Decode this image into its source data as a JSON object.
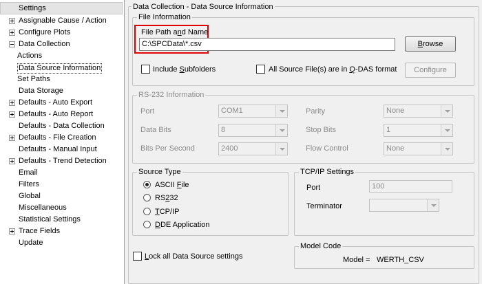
{
  "tree": {
    "header": "Settings",
    "items": [
      {
        "label": "Assignable Cause / Action",
        "expander": "plus"
      },
      {
        "label": "Configure Plots",
        "expander": "plus"
      },
      {
        "label": "Data Collection",
        "expander": "minus"
      },
      {
        "label": "Actions",
        "expander": "none",
        "child": true
      },
      {
        "label": "Data Source Information",
        "expander": "none",
        "child": true,
        "selected": true
      },
      {
        "label": "Set Paths",
        "expander": "none",
        "child": true
      },
      {
        "label": "Data Storage",
        "expander": "none"
      },
      {
        "label": "Defaults - Auto Export",
        "expander": "plus"
      },
      {
        "label": "Defaults - Auto Report",
        "expander": "plus"
      },
      {
        "label": "Defaults - Data Collection",
        "expander": "none"
      },
      {
        "label": "Defaults - File Creation",
        "expander": "plus"
      },
      {
        "label": "Defaults - Manual Input",
        "expander": "none"
      },
      {
        "label": "Defaults - Trend Detection",
        "expander": "plus"
      },
      {
        "label": "Email",
        "expander": "none"
      },
      {
        "label": "Filters",
        "expander": "none"
      },
      {
        "label": "Global",
        "expander": "none"
      },
      {
        "label": "Miscellaneous",
        "expander": "none"
      },
      {
        "label": "Statistical Settings",
        "expander": "none"
      },
      {
        "label": "Trace Fields",
        "expander": "plus"
      },
      {
        "label": "Update",
        "expander": "none"
      }
    ]
  },
  "main_group": {
    "title": "Data Collection - Data Source Information"
  },
  "file_info": {
    "title": "File Information",
    "path_label_pre": "File Path a",
    "path_label_ul": "n",
    "path_label_post": "d Name",
    "path_value": "C:\\SPCData\\*.csv",
    "browse_ul": "B",
    "browse_rest": "rowse",
    "include_pre": "Include ",
    "include_ul": "S",
    "include_post": "ubfolders",
    "all_pre": "All Source File(s) are in ",
    "all_ul": "Q",
    "all_post": "-DAS format",
    "configure_label": "Configure"
  },
  "rs232": {
    "title": "RS-232 Information",
    "port_label": "Port",
    "port_value": "COM1",
    "databits_label": "Data Bits",
    "databits_value": "8",
    "bps_label": "Bits Per Second",
    "bps_value": "2400",
    "parity_label": "Parity",
    "parity_value": "None",
    "stopbits_label": "Stop Bits",
    "stopbits_value": "1",
    "flow_label": "Flow Control",
    "flow_value": "None"
  },
  "source_type": {
    "title": "Source Type",
    "ascii_pre": "ASCII ",
    "ascii_ul": "F",
    "ascii_post": "ile",
    "rs232_pre": "RS",
    "rs232_ul": "2",
    "rs232_post": "32",
    "tcp_pre": "",
    "tcp_ul": "T",
    "tcp_post": "CP/IP",
    "dde_pre": "",
    "dde_ul": "D",
    "dde_post": "DE Application",
    "selected": "ascii"
  },
  "tcpip": {
    "title": "TCP/IP Settings",
    "port_label": "Port",
    "port_value": "100",
    "terminator_label": "Terminator",
    "terminator_value": ""
  },
  "lock": {
    "pre": "",
    "ul": "L",
    "post": "ock all Data Source settings"
  },
  "model": {
    "title": "Model Code",
    "label": "Model =",
    "value": "WERTH_CSV"
  },
  "colors": {
    "highlight": "#e00000",
    "disabled_text": "#8a8a8a"
  }
}
